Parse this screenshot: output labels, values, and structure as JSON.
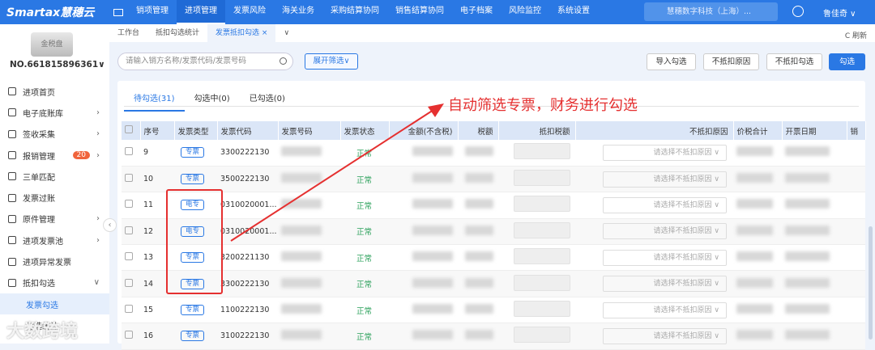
{
  "header": {
    "logo": "Smartax慧穗云",
    "nav": [
      "销项管理",
      "进项管理",
      "发票风险",
      "海关业务",
      "采购结算协同",
      "销售结算协同",
      "电子档案",
      "风险监控",
      "系统设置"
    ],
    "active_nav": 1,
    "company": "慧穗数字科技（上海）...",
    "user": "鲁佳奇 ∨"
  },
  "sidebar": {
    "disk_label": "金税盘",
    "disk_no": "NO.661815896361∨",
    "items": [
      {
        "label": "进项首页",
        "arrow": ""
      },
      {
        "label": "电子底账库",
        "arrow": "›"
      },
      {
        "label": "签收采集",
        "arrow": "›"
      },
      {
        "label": "报销管理",
        "arrow": "›",
        "badge": "20"
      },
      {
        "label": "三单匹配",
        "arrow": ""
      },
      {
        "label": "发票过账",
        "arrow": ""
      },
      {
        "label": "原件管理",
        "arrow": "›"
      },
      {
        "label": "进项发票池",
        "arrow": "›"
      },
      {
        "label": "进项异常发票",
        "arrow": ""
      },
      {
        "label": "抵扣勾选",
        "arrow": "∨"
      }
    ],
    "sub_items": [
      "发票勾选",
      "勾选统计"
    ]
  },
  "tabs": [
    "工作台",
    "抵扣勾选统计",
    "发票抵扣勾选 ×",
    "∨"
  ],
  "refresh": "C 刷新",
  "toolbar": {
    "search_placeholder": "请输入销方名称/发票代码/发票号码",
    "filter": "展开筛选∨",
    "import": "导入勾选",
    "reason": "不抵扣原因",
    "no_deduct": "不抵扣勾选",
    "select": "勾选"
  },
  "content_tabs": [
    "待勾选(31)",
    "勾选中(0)",
    "已勾选(0)"
  ],
  "table": {
    "headers": [
      "序号",
      "发票类型",
      "发票代码",
      "发票号码",
      "发票状态",
      "金额(不含税)",
      "税额",
      "抵扣税额",
      "不抵扣原因",
      "价税合计",
      "开票日期",
      "销"
    ],
    "select_placeholder": "请选择不抵扣原因 ∨",
    "rows": [
      {
        "no": "9",
        "type": "专票",
        "code": "3300222130",
        "status": "正常"
      },
      {
        "no": "10",
        "type": "专票",
        "code": "3500222130",
        "status": "正常"
      },
      {
        "no": "11",
        "type": "电专",
        "code": "0310020001...",
        "status": "正常"
      },
      {
        "no": "12",
        "type": "电专",
        "code": "0310020001...",
        "status": "正常"
      },
      {
        "no": "13",
        "type": "专票",
        "code": "3200221130",
        "status": "正常"
      },
      {
        "no": "14",
        "type": "专票",
        "code": "3300222130",
        "status": "正常"
      },
      {
        "no": "15",
        "type": "专票",
        "code": "1100222130",
        "status": "正常"
      },
      {
        "no": "16",
        "type": "专票",
        "code": "3100222130",
        "status": "正常"
      }
    ]
  },
  "annotation": "自动筛选专票，财务进行勾选",
  "watermark": "大数跨境"
}
